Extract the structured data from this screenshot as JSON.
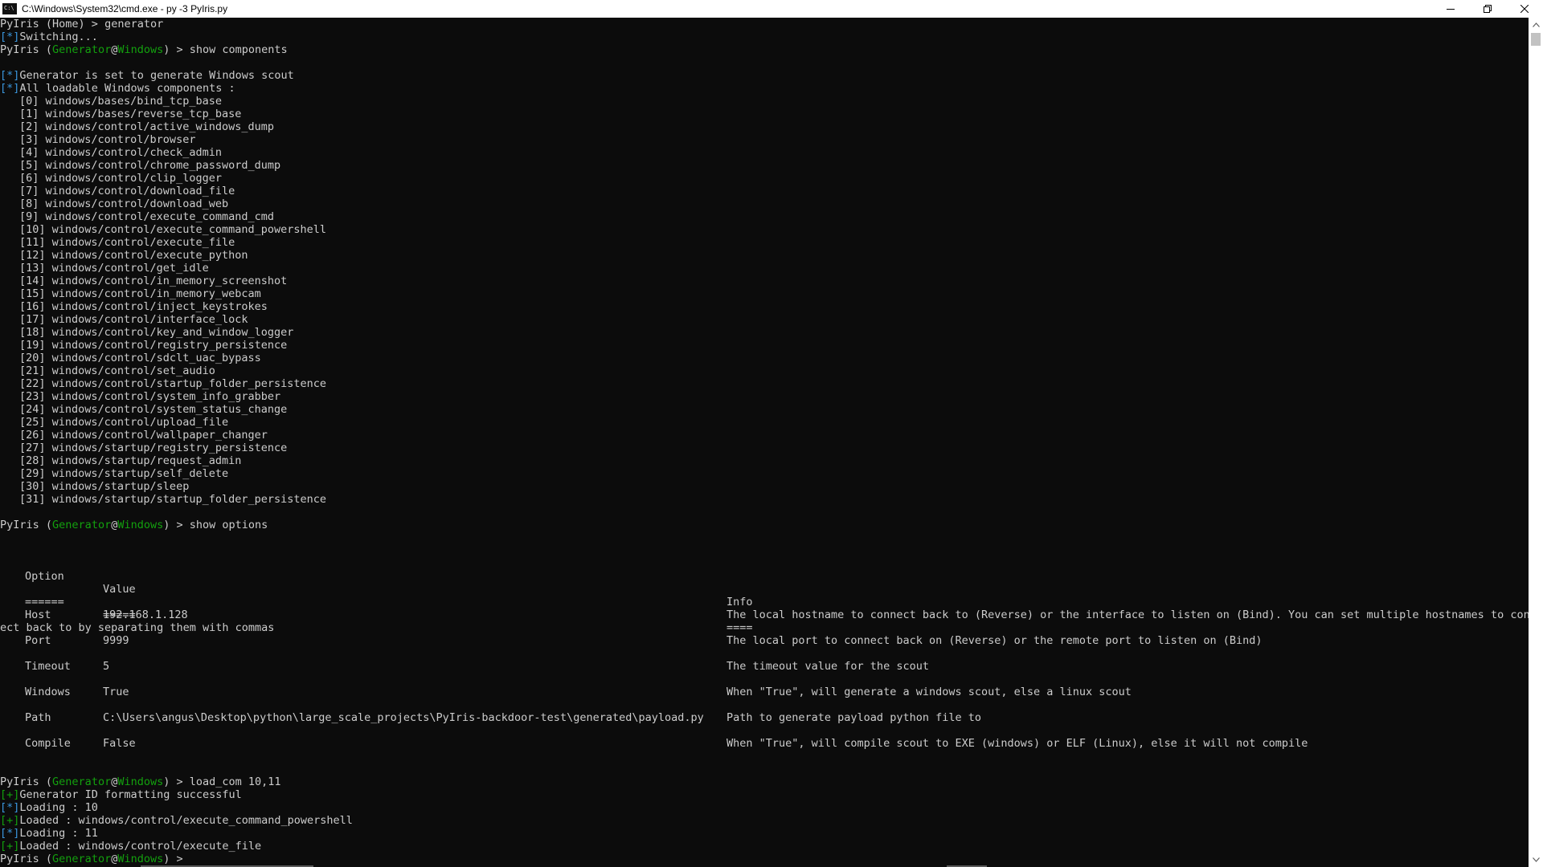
{
  "window": {
    "title": "C:\\Windows\\System32\\cmd.exe - py  -3 PyIris.py"
  },
  "colors": {
    "background": "#0c0c0c",
    "text": "#cccccc",
    "blue": "#3a96dd",
    "green": "#13a10e"
  },
  "prompt": {
    "name": "PyIris",
    "mode": "Generator",
    "at": "@",
    "os": "Windows",
    "home": "PyIris (Home) >"
  },
  "commands": {
    "generator": "generator",
    "show_components": "show components",
    "show_options": "show options",
    "load_com": "load_com 10,11"
  },
  "messages": {
    "switching": "Switching...",
    "set_to_generate": "Generator is set to generate Windows scout",
    "all_loadable": "All loadable Windows components :",
    "id_format": "Generator ID formatting successful",
    "loading_10": "Loading : 10",
    "loaded_10": "Loaded : windows/control/execute_command_powershell",
    "loading_11": "Loading : 11",
    "loaded_11": "Loaded : windows/control/execute_file"
  },
  "markers": {
    "info": "[*]",
    "success": "[+]"
  },
  "components": [
    "[0] windows/bases/bind_tcp_base",
    "[1] windows/bases/reverse_tcp_base",
    "[2] windows/control/active_windows_dump",
    "[3] windows/control/browser",
    "[4] windows/control/check_admin",
    "[5] windows/control/chrome_password_dump",
    "[6] windows/control/clip_logger",
    "[7] windows/control/download_file",
    "[8] windows/control/download_web",
    "[9] windows/control/execute_command_cmd",
    "[10] windows/control/execute_command_powershell",
    "[11] windows/control/execute_file",
    "[12] windows/control/execute_python",
    "[13] windows/control/get_idle",
    "[14] windows/control/in_memory_screenshot",
    "[15] windows/control/in_memory_webcam",
    "[16] windows/control/inject_keystrokes",
    "[17] windows/control/interface_lock",
    "[18] windows/control/key_and_window_logger",
    "[19] windows/control/registry_persistence",
    "[20] windows/control/sdclt_uac_bypass",
    "[21] windows/control/set_audio",
    "[22] windows/control/startup_folder_persistence",
    "[23] windows/control/system_info_grabber",
    "[24] windows/control/system_status_change",
    "[25] windows/control/upload_file",
    "[26] windows/control/wallpaper_changer",
    "[27] windows/startup/registry_persistence",
    "[28] windows/startup/request_admin",
    "[29] windows/startup/self_delete",
    "[30] windows/startup/sleep",
    "[31] windows/startup/startup_folder_persistence"
  ],
  "options_table": {
    "headers": {
      "option": "Option",
      "value": "Value",
      "info": "Info"
    },
    "underlines": {
      "option": "======",
      "value": "=====",
      "info": "===="
    },
    "rows": [
      {
        "option": "Host",
        "value": "192.168.1.128",
        "info": "The local hostname to connect back to (Reverse) or the interface to listen on (Bind). You can set multiple hostnames to conn"
      },
      {
        "option": "Port",
        "value": "9999",
        "info": "The local port to connect back on (Reverse) or the remote port to listen on (Bind)"
      },
      {
        "option": "Timeout",
        "value": "5",
        "info": "The timeout value for the scout"
      },
      {
        "option": "Windows",
        "value": "True",
        "info": "When \"True\", will generate a windows scout, else a linux scout"
      },
      {
        "option": "Path",
        "value": "C:\\Users\\angus\\Desktop\\python\\large_scale_projects\\PyIris-backdoor-test\\generated\\payload.py",
        "info": "Path to generate payload python file to"
      },
      {
        "option": "Compile",
        "value": "False",
        "info": "When \"True\", will compile scout to EXE (windows) or ELF (Linux), else it will not compile"
      }
    ],
    "host_wrap": "ect back to by separating them with commas"
  }
}
